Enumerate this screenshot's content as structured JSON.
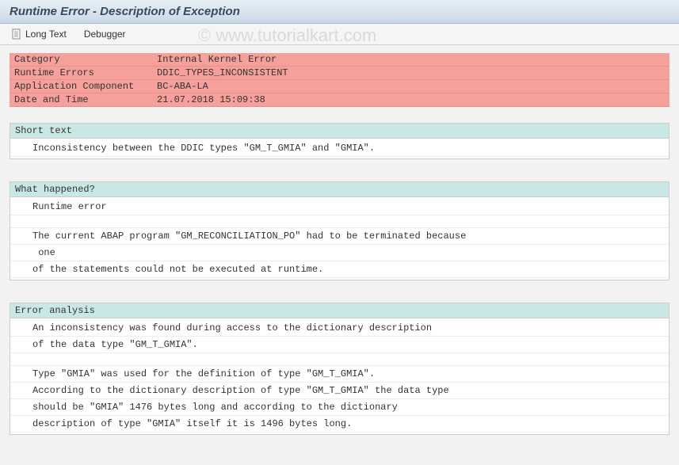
{
  "title": "Runtime Error - Description of Exception",
  "watermark": "© www.tutorialkart.com",
  "toolbar": {
    "longtext_label": "Long Text",
    "debugger_label": "Debugger"
  },
  "info": {
    "rows": [
      {
        "label": "Category",
        "value": "Internal Kernel Error"
      },
      {
        "label": "Runtime Errors",
        "value": "DDIC_TYPES_INCONSISTENT"
      },
      {
        "label": "Application Component",
        "value": "BC-ABA-LA"
      },
      {
        "label": "Date and Time",
        "value": "21.07.2018 15:09:38"
      }
    ]
  },
  "sections": [
    {
      "header": "Short text",
      "lines": [
        "Inconsistency between the DDIC types \"GM_T_GMIA\" and \"GMIA\"."
      ]
    },
    {
      "header": "What happened?",
      "lines": [
        "Runtime error",
        "",
        "The current ABAP program \"GM_RECONCILIATION_PO\" had to be terminated because",
        " one",
        "of the statements could not be executed at runtime."
      ]
    },
    {
      "header": "Error analysis",
      "lines": [
        "An inconsistency was found during access to the dictionary description",
        "of the data type \"GM_T_GMIA\".",
        "",
        "Type \"GMIA\" was used for the definition of type \"GM_T_GMIA\".",
        "According to the dictionary description of type \"GM_T_GMIA\" the data type",
        "should be \"GMIA\" 1476 bytes long and according to the dictionary",
        "description of type \"GMIA\" itself it is 1496 bytes long."
      ]
    }
  ]
}
